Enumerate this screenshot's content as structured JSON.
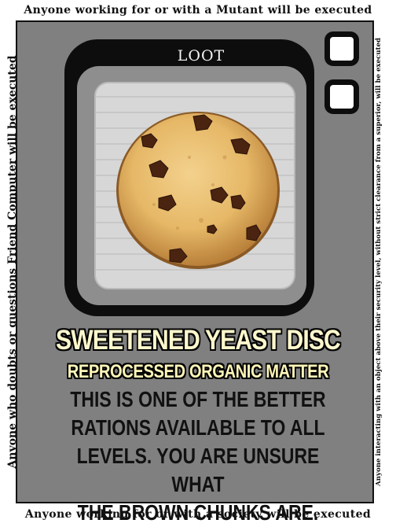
{
  "border": {
    "top": "Anyone working for or with a Mutant will be executed",
    "bottom": "Anyone working for or with a society will be executed",
    "left": "Anyone who doubts or questions Friend Computer will be executed",
    "right": "Anyone interacting with an object above their security level, without strict clearance from a superior, will be executed"
  },
  "card": {
    "category_label": "LOOT",
    "title": "SWEETENED YEAST DISC",
    "subtitle": "REPROCESSED ORGANIC MATTER",
    "description_lines": [
      "THIS IS ONE OF THE BETTER",
      "RATIONS AVAILABLE TO ALL",
      "LEVELS. YOU ARE UNSURE WHAT",
      "THE BROWN CHUNKS ARE."
    ],
    "image": "cookie-icon"
  },
  "colors": {
    "frame": "#808080",
    "panel": "#0d0d0d",
    "title_text": "#fdf7cc",
    "cookie": "#e4b66a"
  }
}
